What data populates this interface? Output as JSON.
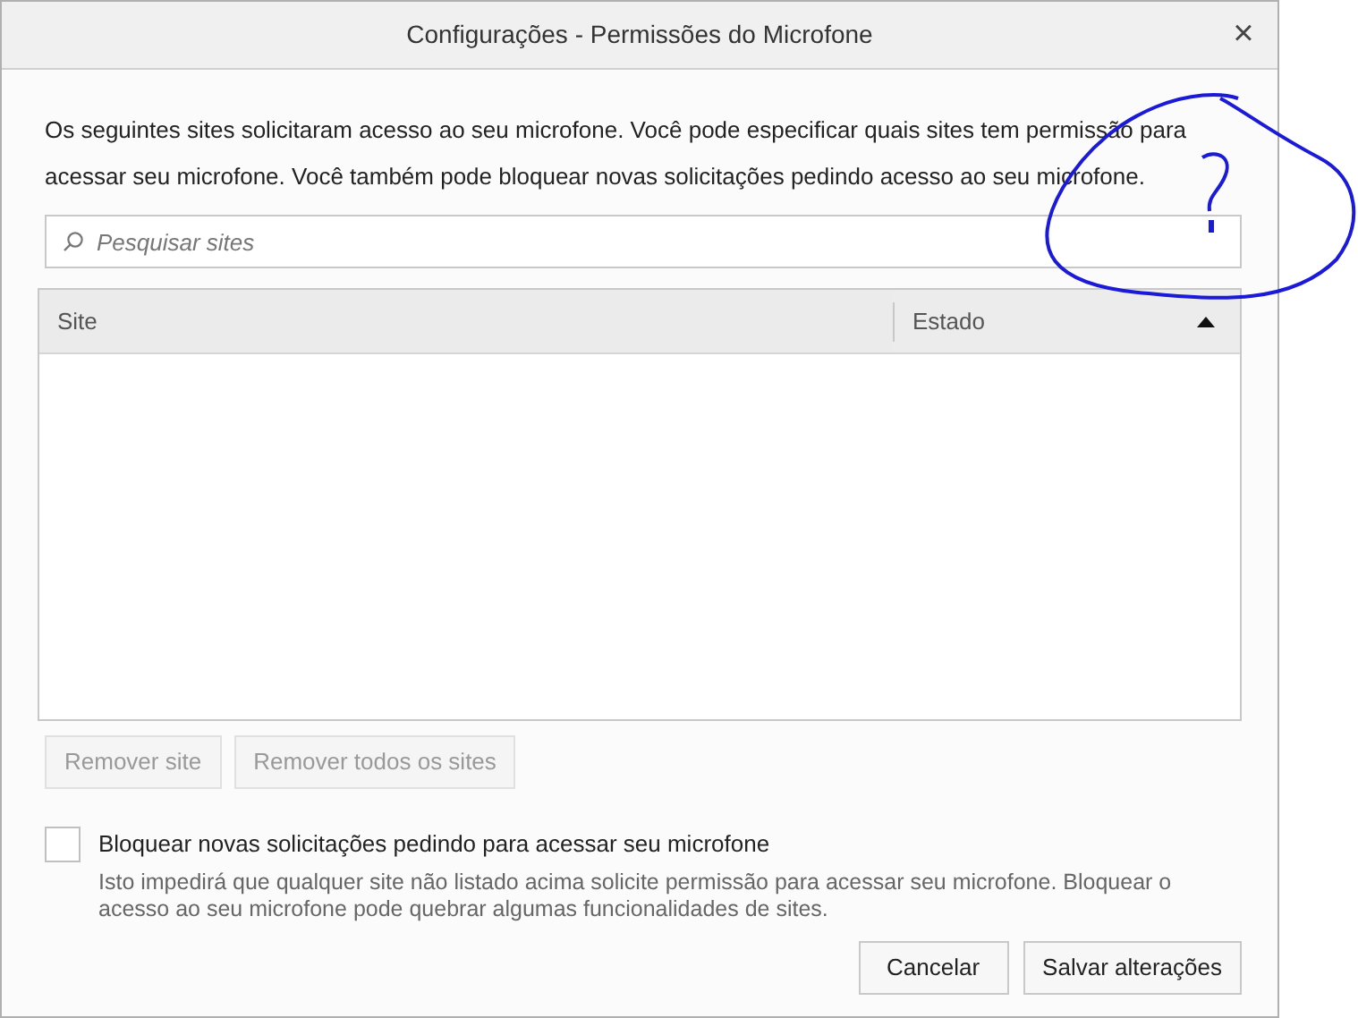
{
  "window": {
    "title": "Configurações - Permissões do Microfone",
    "close": "×"
  },
  "description": "Os seguintes sites solicitaram acesso ao seu microfone. Você pode especificar quais sites tem permissão para acessar seu microfone. Você também pode bloquear novas solicitações pedindo acesso ao seu microfone.",
  "search": {
    "placeholder": "Pesquisar sites"
  },
  "table": {
    "columns": [
      {
        "label": "Site",
        "sorted": false
      },
      {
        "label": "Estado",
        "sorted": true
      }
    ]
  },
  "list_buttons": [
    {
      "label": "Remover site",
      "disabled": true
    },
    {
      "label": "Remover todos os sites",
      "disabled": true
    }
  ],
  "block": {
    "label": "Bloquear novas solicitações pedindo para acessar seu microfone",
    "checked": false,
    "note": "Isto impedirá que qualquer site não listado acima solicite permissão para acessar seu microfone. Bloquear o acesso ao seu microfone pode quebrar algumas funcionalidades de sites."
  },
  "buttons": [
    "Cancelar",
    "Salvar alterações"
  ]
}
